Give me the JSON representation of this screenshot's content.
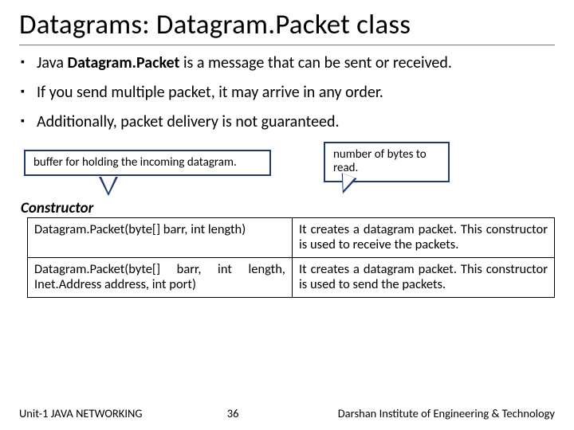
{
  "title": "Datagrams: Datagram.Packet class",
  "bullets": [
    {
      "prefix": "Java ",
      "bold": "Datagram.Packet",
      "rest": " is a message that can be sent or received."
    },
    {
      "prefix": "",
      "bold": "",
      "rest": "If you send multiple packet, it may arrive in any order."
    },
    {
      "prefix": "",
      "bold": "",
      "rest": "Additionally, packet delivery is not guaranteed."
    }
  ],
  "callout_left": "buffer for holding the incoming datagram.",
  "callout_right": "number of bytes to read.",
  "table_heading": "Constructor",
  "rows": [
    {
      "sig": "Datagram.Packet(byte[] barr, int length)",
      "desc": "It creates a datagram packet. This constructor is used to receive the packets."
    },
    {
      "sig": "Datagram.Packet(byte[] barr, int length, Inet.Address address, int port)",
      "desc": "It creates a datagram packet. This constructor is used to send the packets."
    }
  ],
  "footer": {
    "unit": "Unit-1 JAVA NETWORKING",
    "page": "36",
    "inst": "Darshan Institute of Engineering & Technology"
  }
}
